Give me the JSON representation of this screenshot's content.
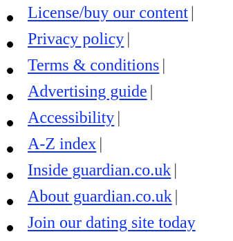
{
  "footer": {
    "links": [
      {
        "label": "License/buy our content",
        "separator": "|"
      },
      {
        "label": "Privacy policy",
        "separator": "|"
      },
      {
        "label": "Terms & conditions",
        "separator": "|"
      },
      {
        "label": "Advertising guide",
        "separator": "|"
      },
      {
        "label": "Accessibility",
        "separator": "|"
      },
      {
        "label": "A-Z index",
        "separator": "|"
      },
      {
        "label": "Inside guardian.co.uk",
        "separator": "|"
      },
      {
        "label": "About guardian.co.uk",
        "separator": "|"
      },
      {
        "label": "Join our dating site today",
        "separator": ""
      }
    ],
    "link_color": "#0f32f0",
    "bullet_color": "#000000"
  }
}
